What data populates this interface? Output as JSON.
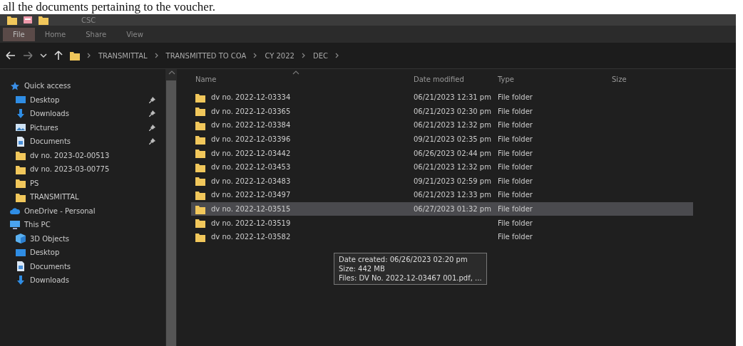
{
  "caption": "all the documents pertaining to the voucher.",
  "window": {
    "title": "CSC"
  },
  "ribbon_tabs": [
    {
      "label": "File",
      "selected": true
    },
    {
      "label": "Home",
      "selected": false
    },
    {
      "label": "Share",
      "selected": false
    },
    {
      "label": "View",
      "selected": false
    }
  ],
  "breadcrumb": [
    "TRANSMITTAL",
    "TRANSMITTED TO COA",
    "CY 2022",
    "DEC"
  ],
  "sidebar": {
    "items": [
      {
        "label": "Quick access",
        "kind": "star",
        "children": [
          {
            "label": "Desktop",
            "kind": "desktop",
            "pinned": true
          },
          {
            "label": "Downloads",
            "kind": "download",
            "pinned": true
          },
          {
            "label": "Pictures",
            "kind": "pictures",
            "pinned": true
          },
          {
            "label": "Documents",
            "kind": "document",
            "pinned": true
          },
          {
            "label": "dv no. 2023-02-00513",
            "kind": "folder",
            "pinned": false
          },
          {
            "label": "dv no. 2023-03-00775",
            "kind": "folder",
            "pinned": false
          },
          {
            "label": "PS",
            "kind": "folder",
            "pinned": false
          },
          {
            "label": "TRANSMITTAL",
            "kind": "folder",
            "pinned": false
          }
        ]
      },
      {
        "label": "OneDrive - Personal",
        "kind": "cloud"
      },
      {
        "label": "This PC",
        "kind": "pc",
        "children": [
          {
            "label": "3D Objects",
            "kind": "objects"
          },
          {
            "label": "Desktop",
            "kind": "desktop"
          },
          {
            "label": "Documents",
            "kind": "document"
          },
          {
            "label": "Downloads",
            "kind": "download"
          }
        ]
      }
    ]
  },
  "table": {
    "columns": [
      "Name",
      "Date modified",
      "Type",
      "Size"
    ],
    "rows": [
      {
        "name": "dv no. 2022-12-03334",
        "date": "06/21/2023 12:31 pm",
        "type": "File folder",
        "selected": false
      },
      {
        "name": "dv no. 2022-12-03365",
        "date": "06/21/2023 02:30 pm",
        "type": "File folder",
        "selected": false
      },
      {
        "name": "dv no. 2022-12-03384",
        "date": "06/21/2023 12:32 pm",
        "type": "File folder",
        "selected": false
      },
      {
        "name": "dv no. 2022-12-03396",
        "date": "09/21/2023 02:35 pm",
        "type": "File folder",
        "selected": false
      },
      {
        "name": "dv no. 2022-12-03442",
        "date": "06/26/2023 02:44 pm",
        "type": "File folder",
        "selected": false
      },
      {
        "name": "dv no. 2022-12-03453",
        "date": "06/21/2023 12:32 pm",
        "type": "File folder",
        "selected": false
      },
      {
        "name": "dv no. 2022-12-03483",
        "date": "09/21/2023 02:59 pm",
        "type": "File folder",
        "selected": false
      },
      {
        "name": "dv no. 2022-12-03497",
        "date": "06/21/2023 12:33 pm",
        "type": "File folder",
        "selected": false
      },
      {
        "name": "dv no. 2022-12-03515",
        "date": "06/27/2023 01:32 pm",
        "type": "File folder",
        "selected": true
      },
      {
        "name": "dv no. 2022-12-03519",
        "type": "File folder",
        "selected": false
      },
      {
        "name": "dv no. 2022-12-03582",
        "type": "File folder",
        "selected": false
      }
    ]
  },
  "tooltip": {
    "lines": [
      "Date created: 06/26/2023 02:20 pm",
      "Size: 442 MB",
      "Files: DV No. 2022-12-03467 001.pdf, ..."
    ]
  }
}
